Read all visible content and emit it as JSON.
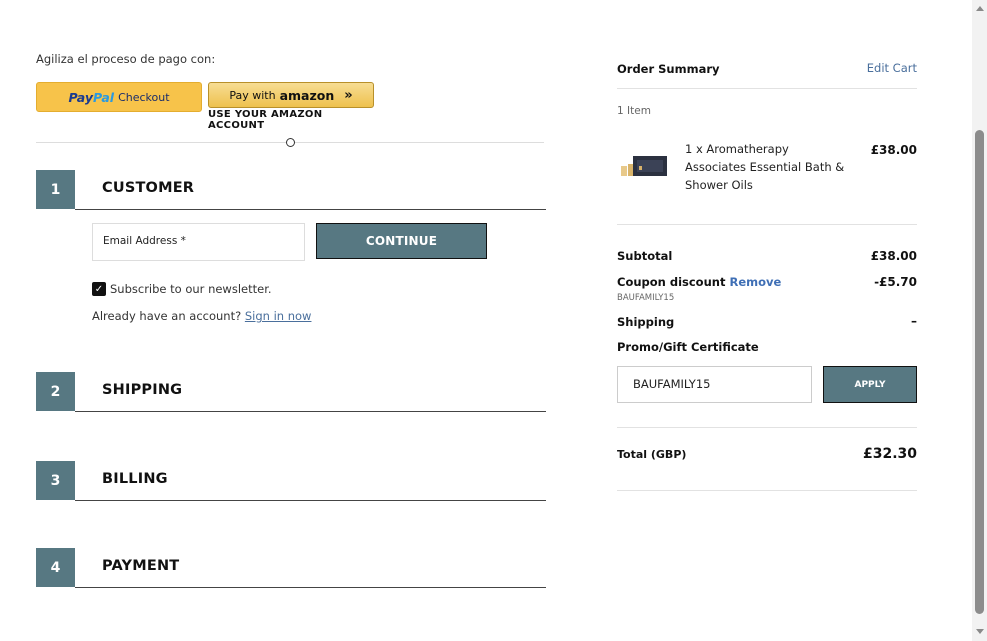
{
  "express": {
    "label": "Agiliza el proceso de pago con:",
    "paypal": {
      "brand_a": "Pay",
      "brand_b": "Pal",
      "action": "Checkout"
    },
    "amazon": {
      "prefix": "Pay with",
      "brand": "amazon",
      "arrows": "»",
      "sub": "USE YOUR AMAZON ACCOUNT"
    }
  },
  "steps": [
    {
      "number": "1",
      "title": "CUSTOMER"
    },
    {
      "number": "2",
      "title": "SHIPPING"
    },
    {
      "number": "3",
      "title": "BILLING"
    },
    {
      "number": "4",
      "title": "PAYMENT"
    }
  ],
  "customer": {
    "email_label": "Email Address *",
    "continue_label": "CONTINUE",
    "newsletter_label": "Subscribe to our newsletter.",
    "account_text": "Already have an account?",
    "sign_in_label": "Sign in now"
  },
  "summary": {
    "title": "Order Summary",
    "edit_cart": "Edit Cart",
    "item_count": "1 Item",
    "product": {
      "name": "1 x Aromatherapy Associates Essential Bath & Shower Oils",
      "price": "£38.00"
    },
    "subtotal_label": "Subtotal",
    "subtotal_value": "£38.00",
    "coupon_label": "Coupon discount",
    "coupon_remove": "Remove",
    "coupon_code": "BAUFAMILY15",
    "coupon_value": "-£5.70",
    "shipping_label": "Shipping",
    "shipping_value": "–",
    "promo_label": "Promo/Gift Certificate",
    "promo_input_value": "BAUFAMILY15",
    "apply_label": "APPLY",
    "total_label": "Total (GBP)",
    "total_value": "£32.30"
  },
  "colors": {
    "accent": "#577882",
    "link": "#4a6f9c",
    "paypal_yellow": "#f7c34a",
    "amazon_gold": "#eec14e"
  }
}
